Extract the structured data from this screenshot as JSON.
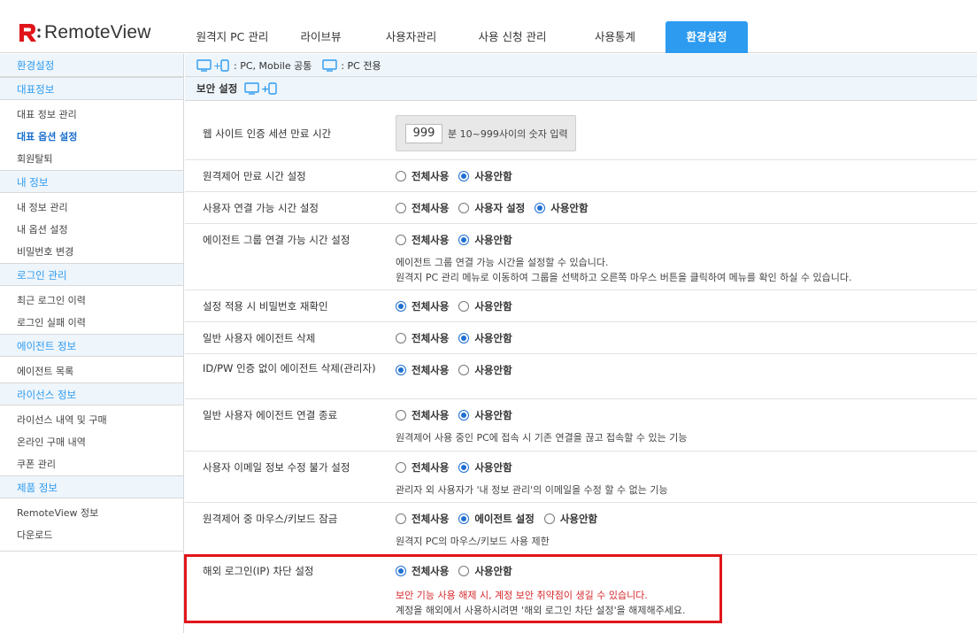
{
  "app": {
    "logo_text": "RemoteView",
    "brand_color": "#e0151b",
    "accent_color": "#2d9bf0"
  },
  "nav": {
    "items": [
      {
        "label": "원격지 PC 관리",
        "active": false
      },
      {
        "label": "라이브뷰",
        "active": false
      },
      {
        "label": "사용자관리",
        "active": false
      },
      {
        "label": "사용 신청 관리",
        "active": false
      },
      {
        "label": "사용통계",
        "active": false
      },
      {
        "label": "환경설정",
        "active": true
      }
    ]
  },
  "sidebar": {
    "title": "환경설정",
    "sections": [
      {
        "title": "대표정보",
        "items": [
          "대표 정보 관리",
          "대표 옵션 설정",
          "회원탈퇴"
        ],
        "active_item": "대표 옵션 설정"
      },
      {
        "title": "내 정보",
        "items": [
          "내 정보 관리",
          "내 옵션 설정",
          "비밀번호 변경"
        ]
      },
      {
        "title": "로그인 관리",
        "items": [
          "최근 로그인 이력",
          "로그인 실패 이력"
        ]
      },
      {
        "title": "에이전트 정보",
        "items": [
          "에이전트 목록"
        ]
      },
      {
        "title": "라이선스 정보",
        "items": [
          "라이선스 내역 및 구매",
          "온라인 구매 내역",
          "쿠폰 관리"
        ]
      },
      {
        "title": "제품 정보",
        "items": [
          "RemoteView 정보",
          "다운로드"
        ]
      }
    ]
  },
  "legend": {
    "common_label": ": PC, Mobile 공통",
    "pc_label": ": PC 전용",
    "icon_common": "monitor-plus-mobile-icon",
    "icon_pc": "monitor-icon"
  },
  "section": {
    "title": "보안 설정"
  },
  "settings": {
    "session": {
      "label": "웹 사이트 인증 세션 만료 시간",
      "value": "999",
      "unit": "분 10~999사이의 숫자 입력"
    },
    "rows": [
      {
        "key": "remote_timeout",
        "label": "원격제어 만료 시간 설정",
        "options": [
          "전체사용",
          "사용안함"
        ],
        "selected": 1,
        "desc": []
      },
      {
        "key": "user_conn_time",
        "label": "사용자 연결 가능 시간 설정",
        "options": [
          "전체사용",
          "사용자 설정",
          "사용안함"
        ],
        "selected": 2,
        "desc": []
      },
      {
        "key": "agent_group_time",
        "label": "에이전트 그룹 연결 가능 시간 설정",
        "options": [
          "전체사용",
          "사용안함"
        ],
        "selected": 1,
        "desc": [
          "에이전트 그룹 연결 가능 시간을 설정할 수 있습니다.",
          "원격지 PC 관리 메뉴로 이동하여 그룹을 선택하고 오른쪽 마우스 버튼을 클릭하여 메뉴를 확인 하실 수 있습니다."
        ]
      },
      {
        "key": "pw_reconfirm",
        "label": "설정 적용 시 비밀번호 재확인",
        "options": [
          "전체사용",
          "사용안함"
        ],
        "selected": 0,
        "desc": []
      },
      {
        "key": "user_agent_delete",
        "label": "일반 사용자 에이전트 삭제",
        "options": [
          "전체사용",
          "사용안함"
        ],
        "selected": 1,
        "desc": []
      },
      {
        "key": "idpw_agent_delete",
        "label": "ID/PW 인증 없이 에이전트 삭제(관리자)",
        "options": [
          "전체사용",
          "사용안함"
        ],
        "selected": 0,
        "desc": []
      },
      {
        "key": "user_agent_disconnect",
        "label": "일반 사용자 에이전트 연결 종료",
        "options": [
          "전체사용",
          "사용안함"
        ],
        "selected": 1,
        "desc": [
          "원격제어 사용 중인 PC에 접속 시 기존 연결을 끊고 접속할 수 있는 기능"
        ]
      },
      {
        "key": "email_lock",
        "label": "사용자 이메일 정보 수정 불가 설정",
        "options": [
          "전체사용",
          "사용안함"
        ],
        "selected": 1,
        "desc": [
          "관리자 외 사용자가 '내 정보 관리'의 이메일을 수정 할 수 없는 기능"
        ]
      },
      {
        "key": "input_lock",
        "label": "원격제어 중 마우스/키보드 잠금",
        "options": [
          "전체사용",
          "에이전트 설정",
          "사용안함"
        ],
        "selected": 1,
        "desc": [
          "원격지 PC의 마우스/키보드 사용 제한"
        ]
      },
      {
        "key": "overseas_block",
        "label": "해외 로그인(IP) 차단 설정",
        "options": [
          "전체사용",
          "사용안함"
        ],
        "selected": 0,
        "desc_red": "보안 기능 사용 해제 시, 계정 보안 취약점이 생길 수 있습니다.",
        "desc": [
          "계정을 해외에서 사용하시려면 '해외 로그인 차단 설정'을 해제해주세요."
        ]
      }
    ]
  }
}
